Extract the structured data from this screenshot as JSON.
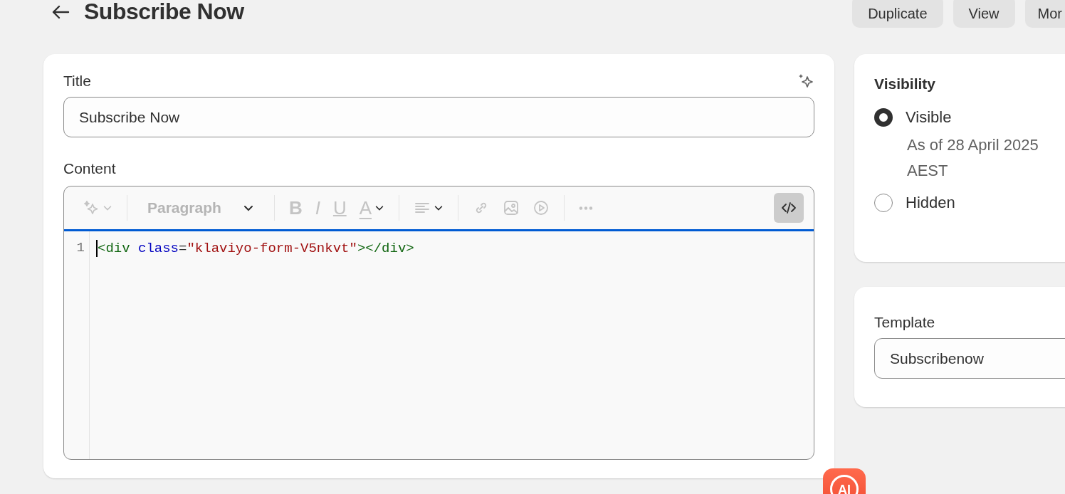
{
  "header": {
    "title": "Subscribe Now",
    "actions": [
      "Duplicate",
      "View",
      "Mor"
    ]
  },
  "main": {
    "title_label": "Title",
    "title_value": "Subscribe Now",
    "content_label": "Content",
    "toolbar": [
      {
        "kind": "sparkle",
        "disabled": true,
        "active": false
      },
      {
        "kind": "select",
        "label": "Paragraph",
        "disabled": true,
        "active": false
      },
      {
        "kind": "bold",
        "label": "B",
        "disabled": true,
        "active": false
      },
      {
        "kind": "italic",
        "label": "I",
        "disabled": true,
        "active": false
      },
      {
        "kind": "underline",
        "label": "U",
        "disabled": true,
        "active": false
      },
      {
        "kind": "textcolor",
        "label": "A",
        "disabled": true,
        "active": false
      },
      {
        "kind": "align",
        "disabled": true,
        "active": false
      },
      {
        "kind": "link",
        "disabled": true,
        "active": false
      },
      {
        "kind": "image",
        "disabled": true,
        "active": false
      },
      {
        "kind": "video",
        "disabled": true,
        "active": false
      },
      {
        "kind": "more",
        "disabled": true,
        "active": false
      },
      {
        "kind": "code",
        "disabled": false,
        "active": true
      }
    ],
    "code_lines": [
      {
        "number": "1",
        "tokens": [
          {
            "kind": "tag",
            "text": "<div"
          },
          {
            "kind": "attr",
            "text": "class"
          },
          {
            "kind": "plain",
            "text": "="
          },
          {
            "kind": "string",
            "text": "\"klaviyo-form-V5nkvt\""
          },
          {
            "kind": "tag",
            "text": "></div>"
          }
        ]
      }
    ]
  },
  "visibility": {
    "title": "Visibility",
    "options": [
      {
        "label": "Visible",
        "selected": true,
        "note": "As of 28 April 2025 AEST"
      },
      {
        "label": "Hidden",
        "selected": false
      }
    ]
  },
  "template": {
    "title": "Template",
    "value": "Subscribenow"
  },
  "ai_badge": {
    "label": "AI"
  }
}
